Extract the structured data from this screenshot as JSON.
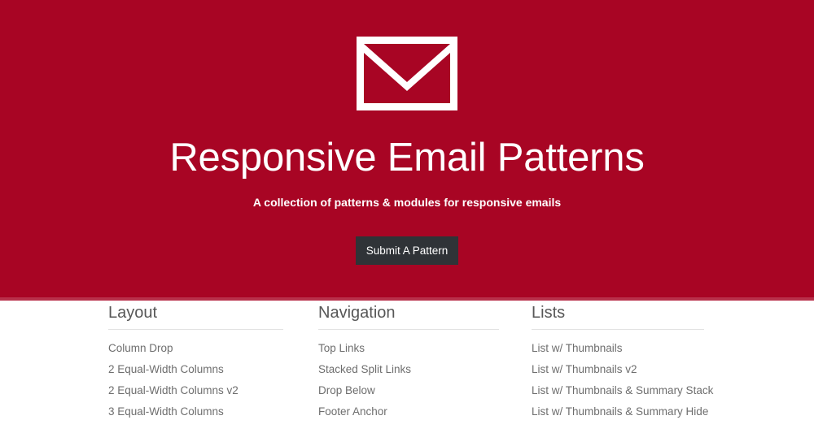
{
  "theme": {
    "hero_background": "#a80524",
    "hero_border": "#b8304a",
    "button_background": "#2f3337",
    "heading_color": "#575757",
    "link_color": "#6e6e6e",
    "divider_color": "#e2e2e2"
  },
  "hero": {
    "logo_icon": "envelope-icon",
    "title": "Responsive Email Patterns",
    "subtitle": "A collection of patterns & modules for responsive emails",
    "submit_button": "Submit A Pattern"
  },
  "columns": [
    {
      "heading": "Layout",
      "items": [
        "Column Drop",
        "2 Equal-Width Columns",
        "2 Equal-Width Columns v2",
        "3 Equal-Width Columns"
      ]
    },
    {
      "heading": "Navigation",
      "items": [
        "Top Links",
        "Stacked Split Links",
        "Drop Below",
        "Footer Anchor"
      ]
    },
    {
      "heading": "Lists",
      "items": [
        "List w/ Thumbnails",
        "List w/ Thumbnails v2",
        "List w/ Thumbnails & Summary Stack",
        "List w/ Thumbnails & Summary Hide"
      ]
    }
  ]
}
